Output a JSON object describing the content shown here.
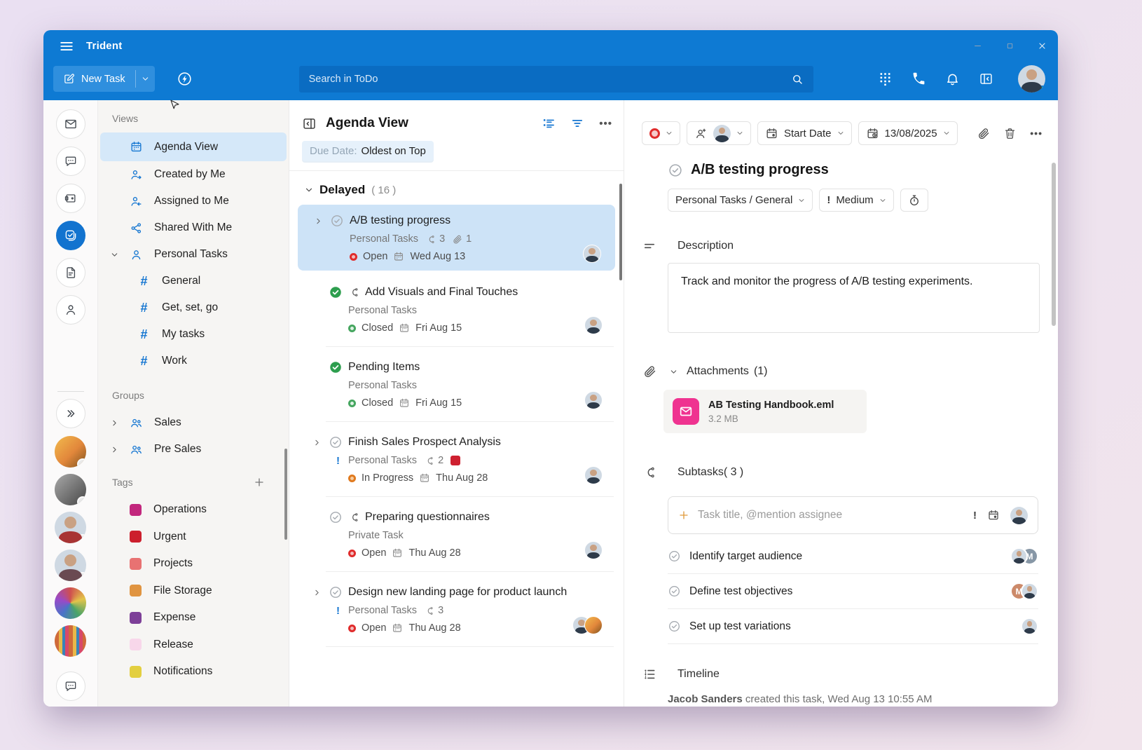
{
  "app": {
    "title": "Trident",
    "accent_color": "#0e7ad3"
  },
  "toolbar": {
    "new_task": "New Task",
    "search_placeholder": "Search in ToDo"
  },
  "sidebar": {
    "views_label": "Views",
    "views": [
      {
        "label": "Agenda View"
      },
      {
        "label": "Created by Me"
      },
      {
        "label": "Assigned to Me"
      },
      {
        "label": "Shared With Me"
      },
      {
        "label": "Personal Tasks"
      }
    ],
    "channels": [
      {
        "label": "General"
      },
      {
        "label": "Get, set, go"
      },
      {
        "label": "My tasks"
      },
      {
        "label": "Work"
      }
    ],
    "groups_label": "Groups",
    "groups": [
      {
        "label": "Sales"
      },
      {
        "label": "Pre Sales"
      }
    ],
    "tags_label": "Tags",
    "tags": [
      {
        "label": "Operations",
        "color": "#c2277d"
      },
      {
        "label": "Urgent",
        "color": "#cc1f2d"
      },
      {
        "label": "Projects",
        "color": "#e87272"
      },
      {
        "label": "File Storage",
        "color": "#e09440"
      },
      {
        "label": "Expense",
        "color": "#7d3f98"
      },
      {
        "label": "Release",
        "color": "#f8d7ea"
      },
      {
        "label": "Notifications",
        "color": "#e3cf3f"
      }
    ]
  },
  "list": {
    "title": "Agenda View",
    "sort_label": "Due Date:",
    "sort_value": "Oldest on Top",
    "section": "Delayed",
    "section_count": "( 16 )",
    "status_colors": {
      "open": "#e02c2c",
      "closed": "#46a660",
      "in_progress": "#e07a1f"
    },
    "tasks": [
      {
        "title": "A/B testing progress",
        "project": "Personal Tasks",
        "subtasks": "3",
        "attachments": "1",
        "status": "Open",
        "due": "Wed Aug 13"
      },
      {
        "title": "Add Visuals and Final Touches",
        "project": "Personal Tasks",
        "status": "Closed",
        "due": "Fri Aug 15"
      },
      {
        "title": "Pending Items",
        "project": "Personal Tasks",
        "status": "Closed",
        "due": "Fri Aug 15"
      },
      {
        "title": "Finish Sales Prospect Analysis",
        "project": "Personal Tasks",
        "subtasks": "2",
        "status": "In Progress",
        "due": "Thu Aug 28"
      },
      {
        "title": "Preparing questionnaires",
        "project": "Private Task",
        "status": "Open",
        "due": "Thu Aug 28"
      },
      {
        "title": "Design new landing page for product launch",
        "project": "Personal Tasks",
        "subtasks": "3",
        "status": "Open",
        "due": "Thu Aug 28"
      }
    ]
  },
  "detail": {
    "start_date_label": "Start Date",
    "due_date": "13/08/2025",
    "title": "A/B testing progress",
    "breadcrumb": "Personal Tasks / General",
    "priority": "Medium",
    "description_label": "Description",
    "description": "Track and monitor the progress of A/B testing experiments.",
    "attachments_label": "Attachments",
    "attachments_count": "(1)",
    "attachment": {
      "name": "AB Testing Handbook.eml",
      "size": "3.2 MB",
      "color": "#ef3390"
    },
    "subtasks_label": "Subtasks( 3 )",
    "subtask_placeholder": "Task title, @mention assignee",
    "subtasks": [
      {
        "title": "Identify target audience",
        "badge": "M"
      },
      {
        "title": "Define test objectives",
        "badge": "M"
      },
      {
        "title": "Set up test variations"
      }
    ],
    "timeline_label": "Timeline",
    "timeline_entry_user": "Jacob Sanders",
    "timeline_entry": "created this task, Wed Aug 13 10:55 AM"
  }
}
